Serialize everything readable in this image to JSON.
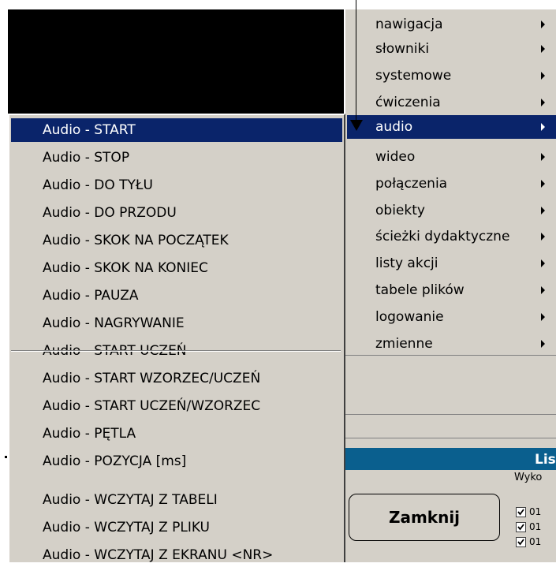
{
  "main_menu": {
    "items": [
      {
        "label": "nawigacja"
      },
      {
        "label": "słowniki"
      },
      {
        "label": "systemowe"
      },
      {
        "label": "ćwiczenia"
      },
      {
        "label": "audio"
      },
      {
        "label": "wideo"
      },
      {
        "label": "połączenia"
      },
      {
        "label": "obiekty"
      },
      {
        "label": "ścieżki dydaktyczne"
      },
      {
        "label": "listy akcji"
      },
      {
        "label": "tabele plików"
      },
      {
        "label": "logowanie"
      },
      {
        "label": "zmienne"
      }
    ],
    "selected": "audio"
  },
  "audio_submenu": {
    "items": [
      {
        "label": "Audio - START"
      },
      {
        "label": "Audio - STOP"
      },
      {
        "label": "Audio - DO TYŁU"
      },
      {
        "label": "Audio - DO PRZODU"
      },
      {
        "label": "Audio - SKOK NA POCZĄTEK"
      },
      {
        "label": "Audio - SKOK NA KONIEC"
      },
      {
        "label": "Audio - PAUZA"
      },
      {
        "label": "Audio - NAGRYWANIE"
      },
      {
        "label": "Audio - START UCZEŃ"
      },
      {
        "label": "Audio - START WZORZEC/UCZEŃ"
      },
      {
        "label": "Audio - START UCZEŃ/WZORZEC"
      },
      {
        "label": "Audio - PĘTLA"
      },
      {
        "label": "Audio - POZYCJA [ms]"
      },
      {
        "label": "Audio - WCZYTAJ Z TABELI"
      },
      {
        "label": "Audio - WCZYTAJ Z PLIKU"
      },
      {
        "label": "Audio - WCZYTAJ Z EKRANU <NR>"
      }
    ],
    "selected": "Audio - START"
  },
  "background": {
    "list_title": "Lis",
    "group_label": "Wyko",
    "close_button": "Zamknij",
    "checkbox_rows": [
      {
        "text": "01",
        "checked": true
      },
      {
        "text": "01",
        "checked": true
      },
      {
        "text": "01",
        "checked": true
      }
    ]
  },
  "colors": {
    "menu_bg": "#d4d0c8",
    "highlight": "#0a246a",
    "header_blue": "#0a5f8e"
  }
}
